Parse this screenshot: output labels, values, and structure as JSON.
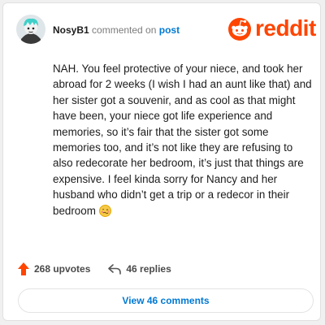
{
  "header": {
    "username": "NosyB1",
    "action_text": "commented on",
    "post_link": "post"
  },
  "brand": {
    "logo_text": "reddit",
    "color": "#ff4500"
  },
  "comment": {
    "text": "NAH. You feel protective of your niece, and took her abroad for 2 weeks (I wish I had an aunt like that) and her sister got a souvenir, and as cool as that might have been, your niece got life experience and memories, so it’s fair that the sister got some memories too, and it’s not like they are refusing to also redecorate her bedroom, it’s just that things are expensive. I feel kinda sorry for Nancy and her husband who didn’t get a trip or a redecor in their bedroom",
    "emoji": "woozy-face-icon"
  },
  "footer": {
    "upvotes": "268 upvotes",
    "replies": "46 replies",
    "upvote_color": "#ff4500"
  },
  "view_button": {
    "label": "View 46 comments",
    "color": "#0079d3"
  }
}
